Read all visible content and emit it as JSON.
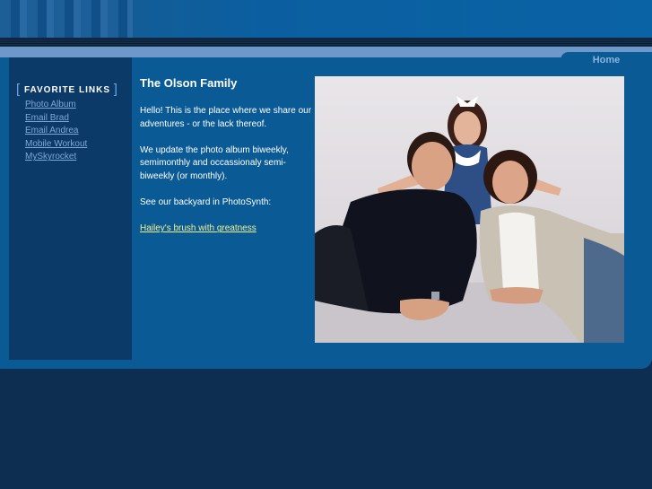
{
  "nav": {
    "home_label": "Home"
  },
  "sidebar": {
    "title": "Favorite Links",
    "links": [
      {
        "label": "Photo Album"
      },
      {
        "label": "Email Brad"
      },
      {
        "label": "Email Andrea"
      },
      {
        "label": "Mobile Workout"
      },
      {
        "label": "MySkyrocket"
      }
    ]
  },
  "content": {
    "title": "The Olson Family",
    "paragraphs": [
      "Hello! This is the place where we share our adventures - or the lack thereof.",
      "We update the photo album biweekly, semimonthly and occassionaly semi-biweekly (or monthly).",
      "See our backyard in PhotoSynth:"
    ],
    "link_text": "Hailey's brush with greatness"
  },
  "colors": {
    "panel": "#0a5a95",
    "sidebar": "#0b3968",
    "link": "#7ea9d6",
    "highlight_link": "#f5f08a"
  }
}
